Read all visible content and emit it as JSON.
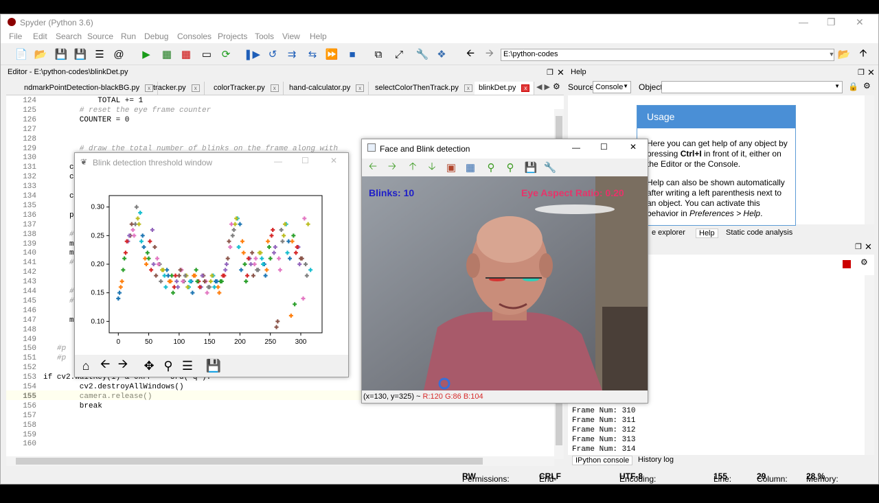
{
  "app": {
    "title": "Spyder (Python 3.6)"
  },
  "menu": [
    "File",
    "Edit",
    "Search",
    "Source",
    "Run",
    "Debug",
    "Consoles",
    "Projects",
    "Tools",
    "View",
    "Help"
  ],
  "toolbar": {
    "path": "E:\\python-codes"
  },
  "editor": {
    "header": "Editor - E:\\python-codes\\blinkDet.py",
    "tabs": [
      "ndmarkPointDetection-blackBG.py",
      "tracker.py",
      "colorTracker.py",
      "hand-calculator.py",
      "selectColorThenTrack.py",
      "blinkDet.py"
    ],
    "active_tab": "blinkDet.py",
    "lines": [
      "124",
      "125",
      "126",
      "127",
      "128",
      "129",
      "130",
      "131",
      "132",
      "133",
      "134",
      "135",
      "136",
      "137",
      "138",
      "139",
      "140",
      "141",
      "142",
      "143",
      "144",
      "145",
      "146",
      "147",
      "148",
      "149",
      "150",
      "151",
      "152",
      "153",
      "154",
      "155",
      "156",
      "157",
      "158",
      "159",
      "160"
    ],
    "current_line": "155",
    "code": [
      {
        "row": 0,
        "ind": "            ",
        "text": "TOTAL += 1",
        "cls": ""
      },
      {
        "row": 1,
        "ind": "        ",
        "text": "# reset the eye frame counter",
        "cls": "cm"
      },
      {
        "row": 2,
        "ind": "        ",
        "text": "COUNTER = 0",
        "cls": ""
      },
      {
        "row": 5,
        "ind": "        ",
        "text": "# draw the total number of blinks on the frame along with",
        "cls": "cm"
      },
      {
        "row": 29,
        "ind": "",
        "text": "if cv2.waitKey(1) & 0xFF == ord('q'):",
        "cls": ""
      },
      {
        "row": 30,
        "ind": "        ",
        "text": "cv2.destroyAllWindows()",
        "cls": ""
      },
      {
        "row": 31,
        "ind": "        ",
        "text": "camera.release()",
        "cls": ""
      },
      {
        "row": 32,
        "ind": "        ",
        "text": "break",
        "cls": ""
      }
    ],
    "fragments": [
      {
        "row": 7,
        "text": "c"
      },
      {
        "row": 8,
        "text": "c"
      },
      {
        "row": 10,
        "text": "c"
      },
      {
        "row": 12,
        "text": "p"
      },
      {
        "row": 14,
        "text": "#"
      },
      {
        "row": 15,
        "text": "m"
      },
      {
        "row": 16,
        "text": "m"
      },
      {
        "row": 17,
        "text": "#"
      },
      {
        "row": 20,
        "text": "#"
      },
      {
        "row": 21,
        "text": "#"
      },
      {
        "row": 23,
        "text": "m"
      },
      {
        "row": 26,
        "text": "#p"
      },
      {
        "row": 27,
        "text": "#p"
      }
    ]
  },
  "help": {
    "header": "Help",
    "source_label": "Source",
    "source_value": "Console",
    "object_label": "Object",
    "usage_title": "Usage",
    "usage_p1a": "Here you can get help of any object by pressing ",
    "usage_p1b": "Ctrl+I",
    "usage_p1c": " in front of it, either on the Editor or the Console.",
    "usage_p2a": "Help can also be shown automatically after writing a left parenthesis next to an object. You can activate this behavior in ",
    "usage_p2b": "Preferences > Help",
    "usage_p2c": ".",
    "tabs": [
      "e explorer",
      "Help",
      "Static code analysis"
    ]
  },
  "console": {
    "frames": [
      "Frame Num:  310",
      "Frame Num:  311",
      "Frame Num:  312",
      "Frame Num:  313",
      "Frame Num:  314"
    ],
    "tabs": [
      "IPython console",
      "History log"
    ]
  },
  "status": {
    "permissions": "Permissions:",
    "perm_val": "RW",
    "eol": "End-of-lines:",
    "eol_val": "CRLF",
    "enc": "Encoding:",
    "enc_val": "UTF-8",
    "line": "Line:",
    "line_val": "155",
    "col": "Column:",
    "col_val": "29",
    "mem": "Memory:",
    "mem_val": "28 %"
  },
  "blink_window": {
    "title": "Blink detection threshold window"
  },
  "face_window": {
    "title": "Face and Blink detection",
    "blinks": "Blinks: 10",
    "ear": "Eye Aspect Ratio: 0.20",
    "pixel_info": "(x=130, y=325) ~ ",
    "pixel_rgb": "R:120 G:86 B:104"
  },
  "chart_data": {
    "type": "scatter",
    "xlim": [
      -15,
      335
    ],
    "ylim": [
      0.08,
      0.32
    ],
    "xticks": [
      0,
      50,
      100,
      150,
      200,
      250,
      300
    ],
    "yticks": [
      "0.10",
      "0.15",
      "0.20",
      "0.25",
      "0.30"
    ],
    "yticks_val": [
      0.1,
      0.15,
      0.2,
      0.25,
      0.3
    ],
    "colors": [
      "#1f77b4",
      "#ff7f0e",
      "#2ca02c",
      "#d62728",
      "#9467bd",
      "#8c564b",
      "#e377c2",
      "#7f7f7f",
      "#bcbd22",
      "#17becf"
    ],
    "x": [
      0,
      4,
      8,
      12,
      16,
      20,
      24,
      28,
      32,
      36,
      40,
      44,
      48,
      52,
      56,
      60,
      64,
      68,
      72,
      76,
      80,
      84,
      88,
      92,
      96,
      100,
      104,
      108,
      112,
      116,
      120,
      124,
      128,
      132,
      136,
      140,
      144,
      148,
      152,
      156,
      160,
      164,
      168,
      172,
      176,
      180,
      184,
      188,
      192,
      196,
      200,
      204,
      208,
      212,
      216,
      220,
      224,
      228,
      232,
      236,
      240,
      244,
      248,
      252,
      256,
      260,
      264,
      268,
      272,
      276,
      280,
      284,
      288,
      292,
      296,
      300,
      304,
      308,
      312,
      316,
      2,
      6,
      10,
      14,
      18,
      22,
      26,
      30,
      34,
      38,
      42,
      46,
      50,
      54,
      58,
      62,
      66,
      70,
      74,
      78,
      82,
      86,
      90,
      94,
      98,
      102,
      106,
      110,
      114,
      118,
      122,
      126,
      130,
      134,
      138,
      142,
      146,
      150,
      154,
      158,
      162,
      166,
      170,
      174,
      178,
      182,
      186,
      190,
      194,
      198,
      202,
      206,
      210,
      214,
      218,
      222,
      226,
      230,
      234,
      238,
      242,
      246,
      250,
      254,
      258,
      262,
      266,
      270,
      274,
      278,
      282,
      286,
      290,
      294,
      298,
      302,
      306,
      310
    ],
    "y": [
      0.14,
      0.16,
      0.19,
      0.22,
      0.24,
      0.25,
      0.26,
      0.27,
      0.28,
      0.29,
      0.25,
      0.21,
      0.22,
      0.24,
      0.26,
      0.23,
      0.21,
      0.2,
      0.19,
      0.18,
      0.19,
      0.17,
      0.18,
      0.16,
      0.17,
      0.18,
      0.19,
      0.17,
      0.18,
      0.16,
      0.17,
      0.18,
      0.19,
      0.17,
      0.16,
      0.18,
      0.17,
      0.16,
      0.17,
      0.18,
      0.17,
      0.16,
      0.17,
      0.18,
      0.19,
      0.21,
      0.23,
      0.25,
      0.27,
      0.28,
      0.27,
      0.24,
      0.2,
      0.18,
      0.21,
      0.22,
      0.2,
      0.19,
      0.22,
      0.21,
      0.2,
      0.19,
      0.23,
      0.25,
      0.22,
      0.09,
      0.21,
      0.26,
      0.25,
      0.27,
      0.24,
      0.11,
      0.25,
      0.22,
      0.23,
      0.21,
      0.14,
      0.2,
      0.27,
      0.19,
      0.15,
      0.17,
      0.21,
      0.24,
      0.25,
      0.27,
      0.25,
      0.3,
      0.27,
      0.24,
      0.23,
      0.2,
      0.21,
      0.19,
      0.2,
      0.18,
      0.2,
      0.17,
      0.19,
      0.16,
      0.18,
      0.17,
      0.15,
      0.18,
      0.16,
      0.19,
      0.17,
      0.18,
      0.16,
      0.17,
      0.15,
      0.18,
      0.17,
      0.16,
      0.18,
      0.17,
      0.15,
      0.16,
      0.18,
      0.16,
      0.17,
      0.15,
      0.17,
      0.18,
      0.2,
      0.24,
      0.27,
      0.26,
      0.28,
      0.23,
      0.19,
      0.22,
      0.17,
      0.21,
      0.2,
      0.18,
      0.21,
      0.19,
      0.22,
      0.2,
      0.18,
      0.24,
      0.21,
      0.26,
      0.23,
      0.1,
      0.19,
      0.24,
      0.27,
      0.22,
      0.21,
      0.24,
      0.13,
      0.23,
      0.2,
      0.21,
      0.28,
      0.18
    ]
  }
}
